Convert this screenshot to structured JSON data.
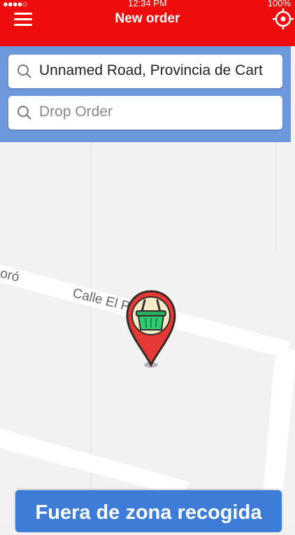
{
  "status_bar": {
    "carrier": "●●●●○ ",
    "time": "12:34 PM",
    "battery": "100%"
  },
  "header": {
    "title": "New order",
    "menu_icon": "hamburger-menu-icon",
    "locate_icon": "crosshair-locate-icon"
  },
  "search": {
    "pickup_value": "Unnamed Road, Provincia de Cart",
    "drop_placeholder": "Drop Order"
  },
  "map": {
    "street_labels": [
      "Calle El P",
      "oró"
    ],
    "pin_icon": "basket-location-pin-icon"
  },
  "action": {
    "label": "Fuera de zona recogida"
  },
  "colors": {
    "header": "#ee0d0d",
    "panel": "#6d99dc",
    "button": "#3d7dd8",
    "pin": "#e53935",
    "basket": "#27ae60"
  }
}
